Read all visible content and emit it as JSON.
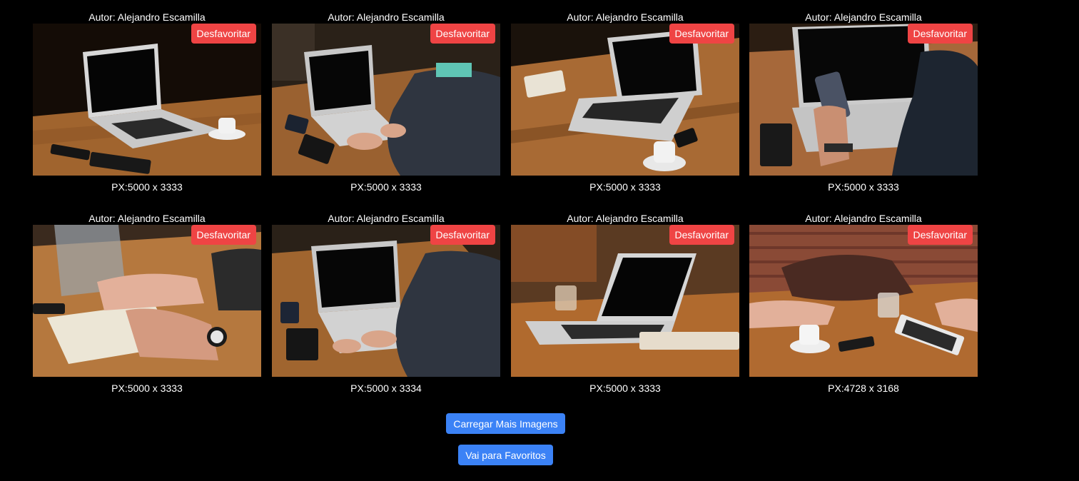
{
  "cards": [
    {
      "author": "Autor: Alejandro Escamilla",
      "button": "Desfavoritar",
      "size": "PX:5000 x 3333",
      "image_icon": "laptop-on-table-photo"
    },
    {
      "author": "Autor: Alejandro Escamilla",
      "button": "Desfavoritar",
      "size": "PX:5000 x 3333",
      "image_icon": "person-typing-laptop-photo"
    },
    {
      "author": "Autor: Alejandro Escamilla",
      "button": "Desfavoritar",
      "size": "PX:5000 x 3333",
      "image_icon": "laptop-coffee-notebook-photo"
    },
    {
      "author": "Autor: Alejandro Escamilla",
      "button": "Desfavoritar",
      "size": "PX:5000 x 3333",
      "image_icon": "hand-holding-phone-photo"
    },
    {
      "author": "Autor: Alejandro Escamilla",
      "button": "Desfavoritar",
      "size": "PX:5000 x 3333",
      "image_icon": "writing-in-notebook-photo"
    },
    {
      "author": "Autor: Alejandro Escamilla",
      "button": "Desfavoritar",
      "size": "PX:5000 x 3334",
      "image_icon": "person-typing-laptop-photo"
    },
    {
      "author": "Autor: Alejandro Escamilla",
      "button": "Desfavoritar",
      "size": "PX:5000 x 3333",
      "image_icon": "laptop-glass-table-photo"
    },
    {
      "author": "Autor: Alejandro Escamilla",
      "button": "Desfavoritar",
      "size": "PX:4728 x 3168",
      "image_icon": "meeting-table-tablet-photo"
    }
  ],
  "actions": {
    "load_more": "Carregar Mais Imagens",
    "go_favorites": "Vai para Favoritos"
  },
  "colors": {
    "background": "#000000",
    "unfavorite_button": "#ef4444",
    "action_button": "#3b82f6",
    "text": "#ffffff"
  }
}
